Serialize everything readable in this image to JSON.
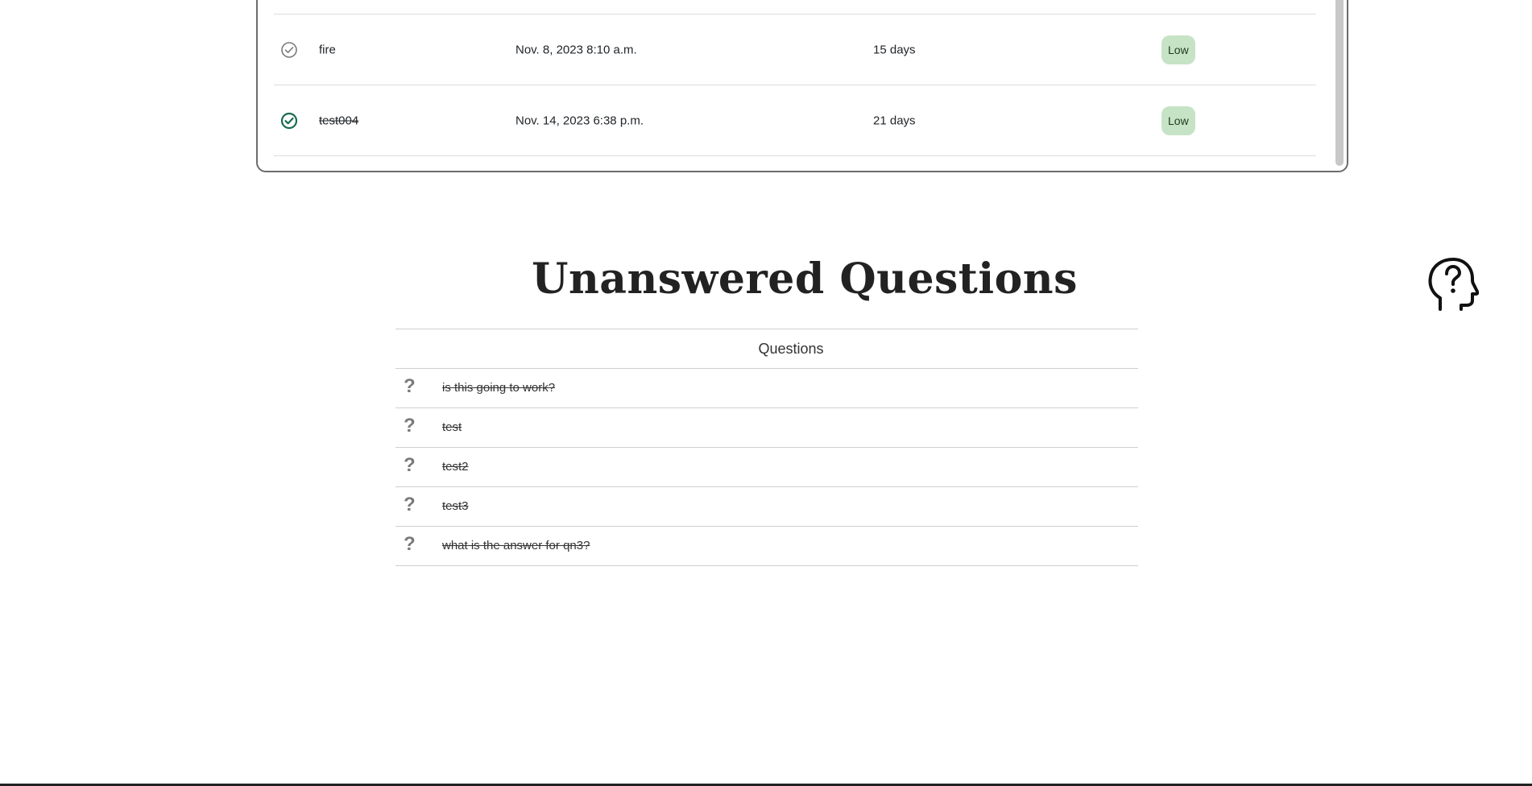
{
  "tasks": {
    "rows": [
      {
        "name": "fire",
        "due": "Nov. 8, 2023 8:10 a.m.",
        "remaining": "15 days",
        "priority": "Low",
        "completed": false,
        "check_icon": "check-circle-outline-icon"
      },
      {
        "name": "test004",
        "due": "Nov. 14, 2023 6:38 p.m.",
        "remaining": "21 days",
        "priority": "Low",
        "completed": true,
        "check_icon": "check-circle-filled-icon"
      }
    ]
  },
  "unanswered": {
    "title": "Unanswered Questions",
    "header": "Questions",
    "icon": "head-question-icon",
    "questions": [
      {
        "mark": "?",
        "text": "is this going to work?"
      },
      {
        "mark": "?",
        "text": "test"
      },
      {
        "mark": "?",
        "text": "test2"
      },
      {
        "mark": "?",
        "text": "test3"
      },
      {
        "mark": "?",
        "text": "what is the answer for qn3?"
      }
    ]
  },
  "colors": {
    "accent_green": "#1a6b4f",
    "priority_low_bg": "#c6e3c6",
    "muted_gray": "#7a7a7a"
  }
}
